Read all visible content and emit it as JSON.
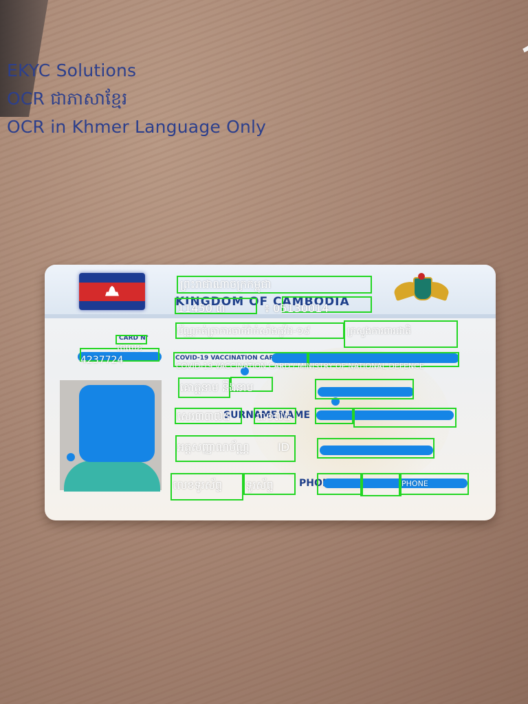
{
  "overlay": {
    "line1": "EKYC Solutions",
    "line2": "OCR ជាភាសាខ្មែរ",
    "line3": "OCR in Khmer Language Only"
  },
  "card_print": {
    "header": "KINGDOM OF CAMBODIA",
    "card_no": "CARD N°",
    "vaccination": "COVID-19 VACCINATION CARD",
    "surname": "SURNAME",
    "name": "NAME",
    "phone": "PHONE"
  },
  "ocr": {
    "r1": "ព្រះរាជាណាចក្រកម្ពុជា",
    "r2a": "11450 ៣",
    "r2b": "៖ 05130014",
    "r3a": "ប័ណ្ណកត់ត្រាការចាក់វ៉ាក់សាំងកូវីដ-១៩",
    "r3b": "ក្រសួងការពារជាតិ",
    "card_code": "ពេលេខ",
    "id_no": "4237724",
    "r4": "COVID-19 VACCINATION CARD / MINISTRY OF NATIONAL DEFENCE",
    "r5a": "គោត្តនាម និងនាម",
    "r6a": "សេរ៣៣៧៥",
    "r6b": "៣១៧៥",
    "r7a": "អត្តសញ្ញាណប័ណ្ណ",
    "r7b": "ID",
    "r8a": "លេខទូរស័ព្ទ",
    "r8b": "ទូរស័ព្ទ",
    "r8c": "PHONE"
  },
  "colors": {
    "overlay_text": "#2c3f8c",
    "box": "#22d622",
    "redaction": "#1585e6"
  }
}
